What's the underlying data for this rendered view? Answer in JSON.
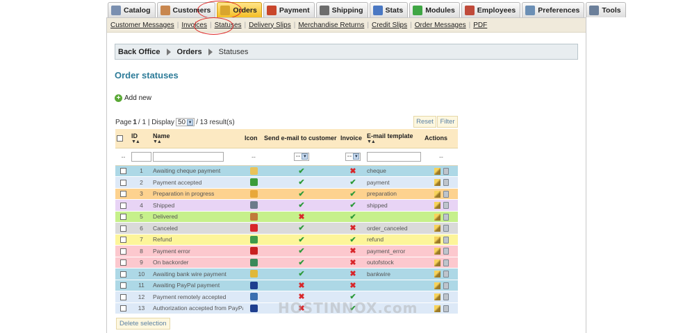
{
  "tabs": [
    {
      "label": "Catalog",
      "icon": "catalog-icon",
      "color": "#7a8fb0",
      "active": false
    },
    {
      "label": "Customers",
      "icon": "customers-icon",
      "color": "#c8874f",
      "active": false
    },
    {
      "label": "Orders",
      "icon": "orders-icon",
      "color": "#d9a52d",
      "active": true
    },
    {
      "label": "Payment",
      "icon": "payment-icon",
      "color": "#c9462b",
      "active": false
    },
    {
      "label": "Shipping",
      "icon": "shipping-icon",
      "color": "#6d6d6d",
      "active": false
    },
    {
      "label": "Stats",
      "icon": "stats-icon",
      "color": "#4a78c3",
      "active": false
    },
    {
      "label": "Modules",
      "icon": "modules-icon",
      "color": "#3fa644",
      "active": false
    },
    {
      "label": "Employees",
      "icon": "employees-icon",
      "color": "#c04a3a",
      "active": false
    },
    {
      "label": "Preferences",
      "icon": "preferences-icon",
      "color": "#6b8fb5",
      "active": false
    },
    {
      "label": "Tools",
      "icon": "tools-icon",
      "color": "#6b7f9a",
      "active": false
    }
  ],
  "subnav": [
    "Customer Messages",
    "Invoices",
    "Statuses",
    "Delivery Slips",
    "Merchandise Returns",
    "Credit Slips",
    "Order Messages",
    "PDF"
  ],
  "breadcrumb": {
    "root": "Back Office",
    "section": "Orders",
    "current": "Statuses"
  },
  "page_title": "Order statuses",
  "add_new": "Add new",
  "pager": {
    "prefix": "Page",
    "current": "1",
    "total_text": "/ 1 | Display",
    "per_page": "50",
    "results": "/ 13 result(s)"
  },
  "buttons": {
    "reset": "Reset",
    "filter": "Filter",
    "delete_selection": "Delete selection"
  },
  "columns": {
    "id": "ID",
    "name": "Name",
    "icon": "Icon",
    "send_email": "Send e-mail to customer",
    "invoice": "Invoice",
    "email_template": "E-mail template",
    "actions": "Actions"
  },
  "filter_row": {
    "dash": "--",
    "select_value": "--"
  },
  "rows": [
    {
      "id": "1",
      "name": "Awaiting cheque payment",
      "icon": "envelope-icon",
      "icon_color": "#e8c35a",
      "send_email": true,
      "invoice": false,
      "template": "cheque",
      "bg": "#add8e6"
    },
    {
      "id": "2",
      "name": "Payment accepted",
      "icon": "checkmark-icon",
      "icon_color": "#3a9c3a",
      "send_email": true,
      "invoice": true,
      "template": "payment",
      "bg": "#dde9f7"
    },
    {
      "id": "3",
      "name": "Preparation in progress",
      "icon": "box-icon",
      "icon_color": "#e8a83a",
      "send_email": true,
      "invoice": true,
      "template": "preparation",
      "bg": "#fdd28f"
    },
    {
      "id": "4",
      "name": "Shipped",
      "icon": "truck-icon",
      "icon_color": "#6b7b8b",
      "send_email": true,
      "invoice": true,
      "template": "shipped",
      "bg": "#e8d4f5"
    },
    {
      "id": "5",
      "name": "Delivered",
      "icon": "package-icon",
      "icon_color": "#c07a3a",
      "send_email": false,
      "invoice": true,
      "template": "",
      "bg": "#c6f08b"
    },
    {
      "id": "6",
      "name": "Canceled",
      "icon": "cancel-icon",
      "icon_color": "#d8262a",
      "send_email": true,
      "invoice": false,
      "template": "order_canceled",
      "bg": "#dadada"
    },
    {
      "id": "7",
      "name": "Refund",
      "icon": "refund-icon",
      "icon_color": "#3f9a4a",
      "send_email": true,
      "invoice": true,
      "template": "refund",
      "bg": "#fdf59a"
    },
    {
      "id": "8",
      "name": "Payment error",
      "icon": "error-icon",
      "icon_color": "#c82020",
      "send_email": true,
      "invoice": false,
      "template": "payment_error",
      "bg": "#fcc8ce"
    },
    {
      "id": "9",
      "name": "On backorder",
      "icon": "backorder-icon",
      "icon_color": "#3a8a5a",
      "send_email": true,
      "invoice": false,
      "template": "outofstock",
      "bg": "#fcc8ce"
    },
    {
      "id": "10",
      "name": "Awaiting bank wire payment",
      "icon": "coins-icon",
      "icon_color": "#e0b83a",
      "send_email": true,
      "invoice": false,
      "template": "bankwire",
      "bg": "#add8e6"
    },
    {
      "id": "11",
      "name": "Awaiting PayPal payment",
      "icon": "paypal-icon",
      "icon_color": "#1f3f8f",
      "send_email": false,
      "invoice": false,
      "template": "",
      "bg": "#add8e6"
    },
    {
      "id": "12",
      "name": "Payment remotely accepted",
      "icon": "remote-payment-icon",
      "icon_color": "#3a6fb0",
      "send_email": false,
      "invoice": true,
      "template": "",
      "bg": "#dde9f7"
    },
    {
      "id": "13",
      "name": "Authorization accepted from PayPal",
      "icon": "paypal-icon",
      "icon_color": "#1f3f8f",
      "send_email": false,
      "invoice": true,
      "template": "",
      "bg": "#dde9f7"
    }
  ],
  "watermark": "HOSTINNOX.com"
}
